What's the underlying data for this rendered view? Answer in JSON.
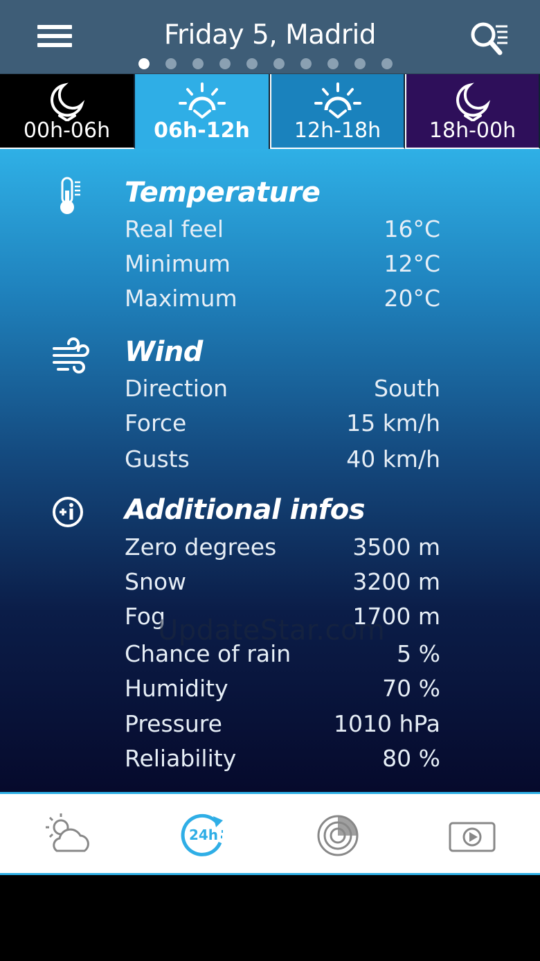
{
  "header": {
    "title": "Friday 5, Madrid",
    "page_count": 10,
    "active_page_index": 0
  },
  "tabs": [
    {
      "label": "00h-06h",
      "icon": "moon-icon",
      "active": false
    },
    {
      "label": "06h-12h",
      "icon": "sunrise-icon",
      "active": true
    },
    {
      "label": "12h-18h",
      "icon": "sunrise-icon",
      "active": false
    },
    {
      "label": "18h-00h",
      "icon": "moon-icon",
      "active": false
    }
  ],
  "temperature": {
    "title": "Temperature",
    "rows": [
      {
        "label": "Real feel",
        "value": "16°C"
      },
      {
        "label": "Minimum",
        "value": "12°C"
      },
      {
        "label": "Maximum",
        "value": "20°C"
      }
    ]
  },
  "wind": {
    "title": "Wind",
    "rows": [
      {
        "label": "Direction",
        "value": "South"
      },
      {
        "label": "Force",
        "value": "15 km/h"
      },
      {
        "label": "Gusts",
        "value": "40 km/h"
      }
    ]
  },
  "additional": {
    "title": "Additional infos",
    "rows": [
      {
        "label": "Zero degrees",
        "value": "3500 m"
      },
      {
        "label": "Snow",
        "value": "3200 m"
      },
      {
        "label": "Fog",
        "value": "1700 m"
      },
      {
        "label": "Chance of rain",
        "value": "5 %"
      },
      {
        "label": "Humidity",
        "value": "70 %"
      },
      {
        "label": "Pressure",
        "value": "1010 hPa"
      },
      {
        "label": "Reliability",
        "value": "80 %"
      }
    ]
  },
  "watermark": "UpdateStar.com",
  "bottom_nav": [
    {
      "icon": "weather-cloud-sun-icon"
    },
    {
      "icon": "24h-forecast-icon",
      "text": "24h",
      "active": true
    },
    {
      "icon": "radar-icon"
    },
    {
      "icon": "video-play-icon"
    }
  ],
  "colors": {
    "accent": "#2faee6",
    "header_bg": "#3e5d77",
    "tab_night": "#000000",
    "tab_evening": "#2e0f5a"
  }
}
